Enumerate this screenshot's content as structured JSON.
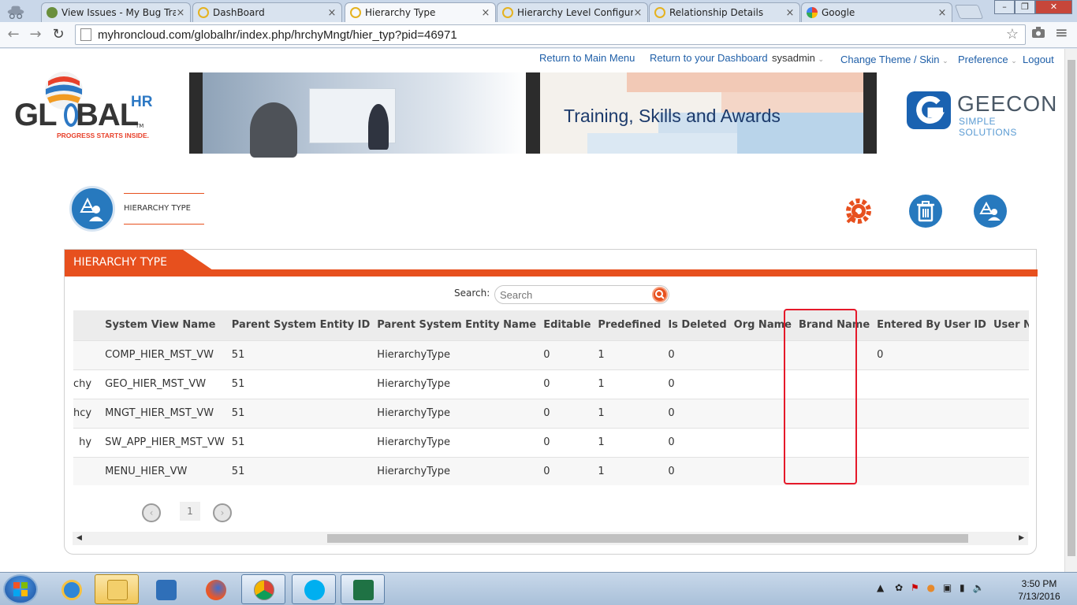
{
  "browser": {
    "tabs": [
      {
        "label": "View Issues - My Bug Trac",
        "icon": "bug-icon",
        "color": "#6a8f3c"
      },
      {
        "label": "DashBoard",
        "icon": "loading-icon",
        "color": "#e5b21e"
      },
      {
        "label": "Hierarchy Type",
        "icon": "loading-icon",
        "color": "#e5b21e",
        "active": true
      },
      {
        "label": "Hierarchy Level Configura",
        "icon": "loading-icon",
        "color": "#e5b21e"
      },
      {
        "label": "Relationship Details",
        "icon": "loading-icon",
        "color": "#e5b21e"
      },
      {
        "label": "Google",
        "icon": "google-icon",
        "color": "#4285f4"
      }
    ],
    "url": "myhroncloud.com/globalhr/index.php/hrchyMngt/hier_typ?pid=46971"
  },
  "header": {
    "links": {
      "main_menu": "Return to Main Menu",
      "dashboard": "Return to your Dashboard",
      "user": "sysadmin",
      "theme": "Change Theme / Skin",
      "preference": "Preference",
      "logout": "Logout"
    },
    "logo_main": "GL",
    "logo_main2": "BAL",
    "logo_hr": "HR",
    "logo_tm": "TM",
    "logo_tagline": "PROGRESS STARTS INSIDE.",
    "banner_title": "Training, Skills and Awards",
    "partner_name": "GEECON",
    "partner_tagline": "SIMPLE SOLUTIONS"
  },
  "page": {
    "crumb": "HIERARCHY TYPE",
    "section_title": "HIERARCHY TYPE",
    "search_label": "Search:",
    "search_placeholder": "Search",
    "columns": [
      "System View Name",
      "Parent System Entity ID",
      "Parent System Entity Name",
      "Editable",
      "Predefined",
      "Is Deleted",
      "Org Name",
      "Brand Name",
      "Entered By User ID",
      "User Nam"
    ],
    "rows": [
      {
        "lead": "",
        "view": "COMP_HIER_MST_VW",
        "pid": "51",
        "pname": "HierarchyType",
        "editable": "0",
        "predefined": "1",
        "deleted": "0",
        "org": "",
        "brand": "",
        "entered": "0",
        "user": ""
      },
      {
        "lead": "chy",
        "view": "GEO_HIER_MST_VW",
        "pid": "51",
        "pname": "HierarchyType",
        "editable": "0",
        "predefined": "1",
        "deleted": "0",
        "org": "",
        "brand": "",
        "entered": "",
        "user": ""
      },
      {
        "lead": "hcy",
        "view": "MNGT_HIER_MST_VW",
        "pid": "51",
        "pname": "HierarchyType",
        "editable": "0",
        "predefined": "1",
        "deleted": "0",
        "org": "",
        "brand": "",
        "entered": "",
        "user": ""
      },
      {
        "lead": "hy",
        "view": "SW_APP_HIER_MST_VW",
        "pid": "51",
        "pname": "HierarchyType",
        "editable": "0",
        "predefined": "1",
        "deleted": "0",
        "org": "",
        "brand": "",
        "entered": "",
        "user": ""
      },
      {
        "lead": "",
        "view": "MENU_HIER_VW",
        "pid": "51",
        "pname": "HierarchyType",
        "editable": "0",
        "predefined": "1",
        "deleted": "0",
        "org": "",
        "brand": "",
        "entered": "",
        "user": ""
      }
    ],
    "pager": {
      "prev": "‹",
      "current": "1",
      "next": "›"
    }
  },
  "taskbar": {
    "apps": [
      "start-orb",
      "internet-explorer",
      "file-explorer",
      "media-player",
      "firefox",
      "chrome",
      "skype",
      "excel"
    ],
    "time": "3:50 PM",
    "date": "7/13/2016"
  },
  "colors": {
    "accent": "#e7501e",
    "brand_blue": "#2779be",
    "highlight_box": "#e5192a"
  }
}
